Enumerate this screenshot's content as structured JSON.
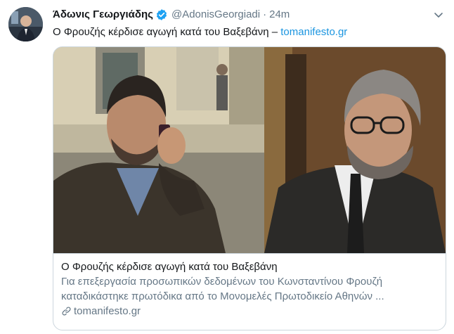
{
  "tweet": {
    "author": {
      "display_name": "Άδωνις Γεωργιάδης",
      "handle": "@AdonisGeorgiadi",
      "verified": true
    },
    "separator": "·",
    "time": "24m",
    "text": "Ο Φρουζής κέρδισε αγωγή κατά του Βαξεβάνη –",
    "link_text": "tomanifesto.gr",
    "card": {
      "title": "Ο Φρουζής κέρδισε αγωγή κατά του Βαξεβάνη",
      "description": "Για επεξεργασία προσωπικών δεδομένων του Κωνσταντίνου Φρουζή καταδικάστηκε πρωτόδικα από το Μονομελές Πρωτοδικείο Αθηνών ...",
      "domain": "tomanifesto.gr"
    },
    "icons": {
      "verified": "verified-badge-icon",
      "caret": "chevron-down-icon",
      "link": "link-icon"
    },
    "colors": {
      "accent": "#1b95e0",
      "secondary_text": "#657786",
      "border": "#ccd6dd"
    }
  }
}
